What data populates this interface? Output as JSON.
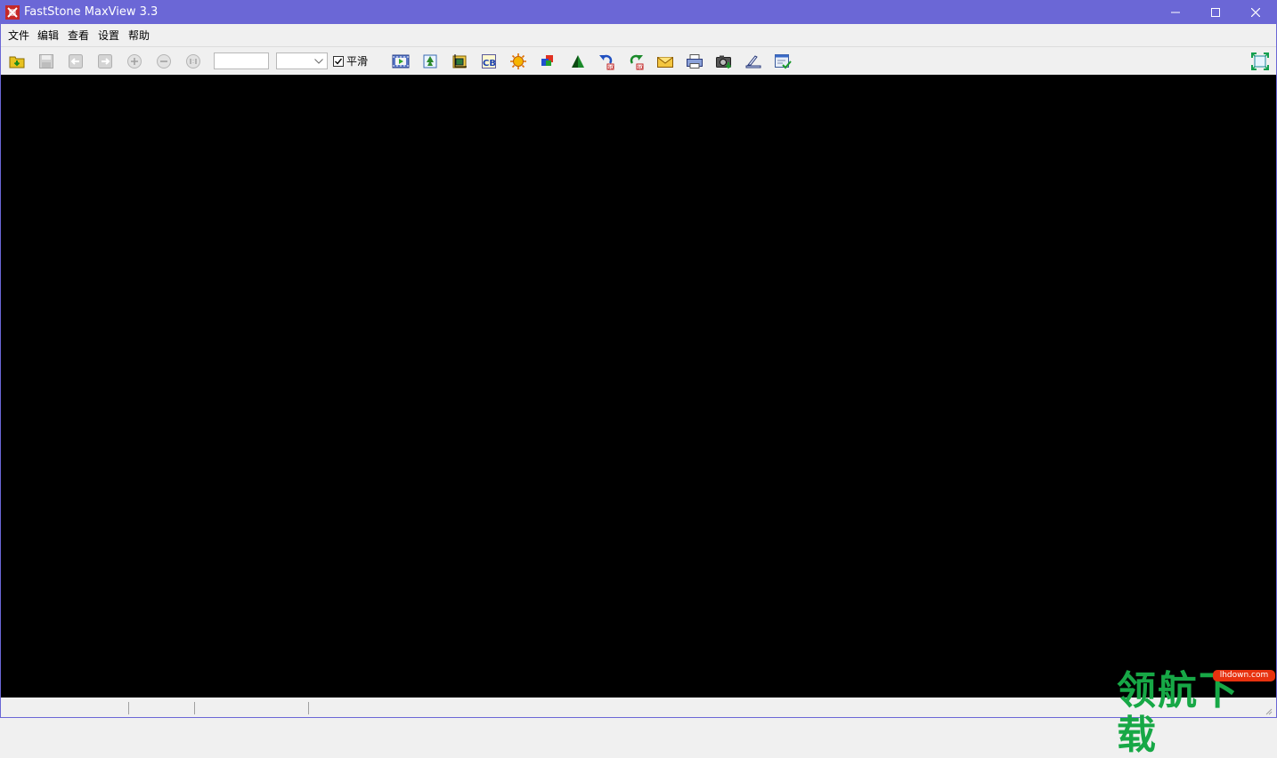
{
  "window": {
    "title": "FastStone MaxView 3.3"
  },
  "colors": {
    "titlebar": "#6b67d6",
    "canvas": "#000000",
    "watermark_green": "#17a846",
    "watermark_red": "#e8320f"
  },
  "menu": {
    "items": [
      "文件",
      "编辑",
      "查看",
      "设置",
      "帮助"
    ]
  },
  "toolbar": {
    "zoom_value": "",
    "zoom_option": "",
    "smooth_checked": true,
    "smooth_label": "平滑",
    "icons": [
      "open-icon",
      "save-icon",
      "prev-icon",
      "next-icon",
      "zoom-in-icon",
      "zoom-out-icon",
      "actual-size-icon",
      "slideshow-icon",
      "resize-icon",
      "crop-icon",
      "text-icon",
      "brightness-icon",
      "colors-icon",
      "sharpen-icon",
      "rotate-left-icon",
      "rotate-right-icon",
      "email-icon",
      "print-icon",
      "capture-icon",
      "scan-icon",
      "settings-icon",
      "fullscreen-icon"
    ]
  },
  "watermark": {
    "text": "领航下载",
    "url": "lhdown.com"
  }
}
